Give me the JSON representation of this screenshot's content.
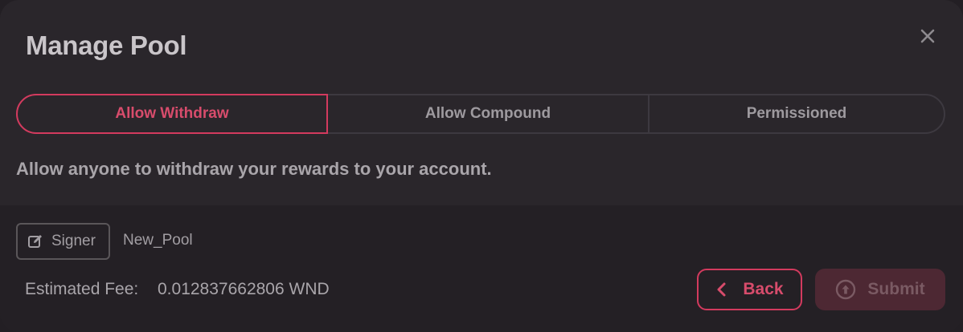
{
  "modal": {
    "title": "Manage Pool",
    "close_icon": "close-icon"
  },
  "tabs": [
    {
      "label": "Allow Withdraw",
      "active": true
    },
    {
      "label": "Allow Compound",
      "active": false
    },
    {
      "label": "Permissioned",
      "active": false
    }
  ],
  "description": "Allow anyone to withdraw your rewards to your account.",
  "signer": {
    "label": "Signer",
    "icon": "edit-icon",
    "account": "New_Pool"
  },
  "fee": {
    "label": "Estimated Fee:",
    "value": "0.012837662806 WND"
  },
  "actions": {
    "back_label": "Back",
    "back_icon": "chevron-left-icon",
    "submit_label": "Submit",
    "submit_icon": "arrow-up-circle-icon",
    "submit_disabled": true
  },
  "colors": {
    "accent": "#d33a5e",
    "background": "#2a262b",
    "footer_background": "#242025",
    "text": "#a9a5aa",
    "submit_disabled_bg": "#4d2833"
  }
}
